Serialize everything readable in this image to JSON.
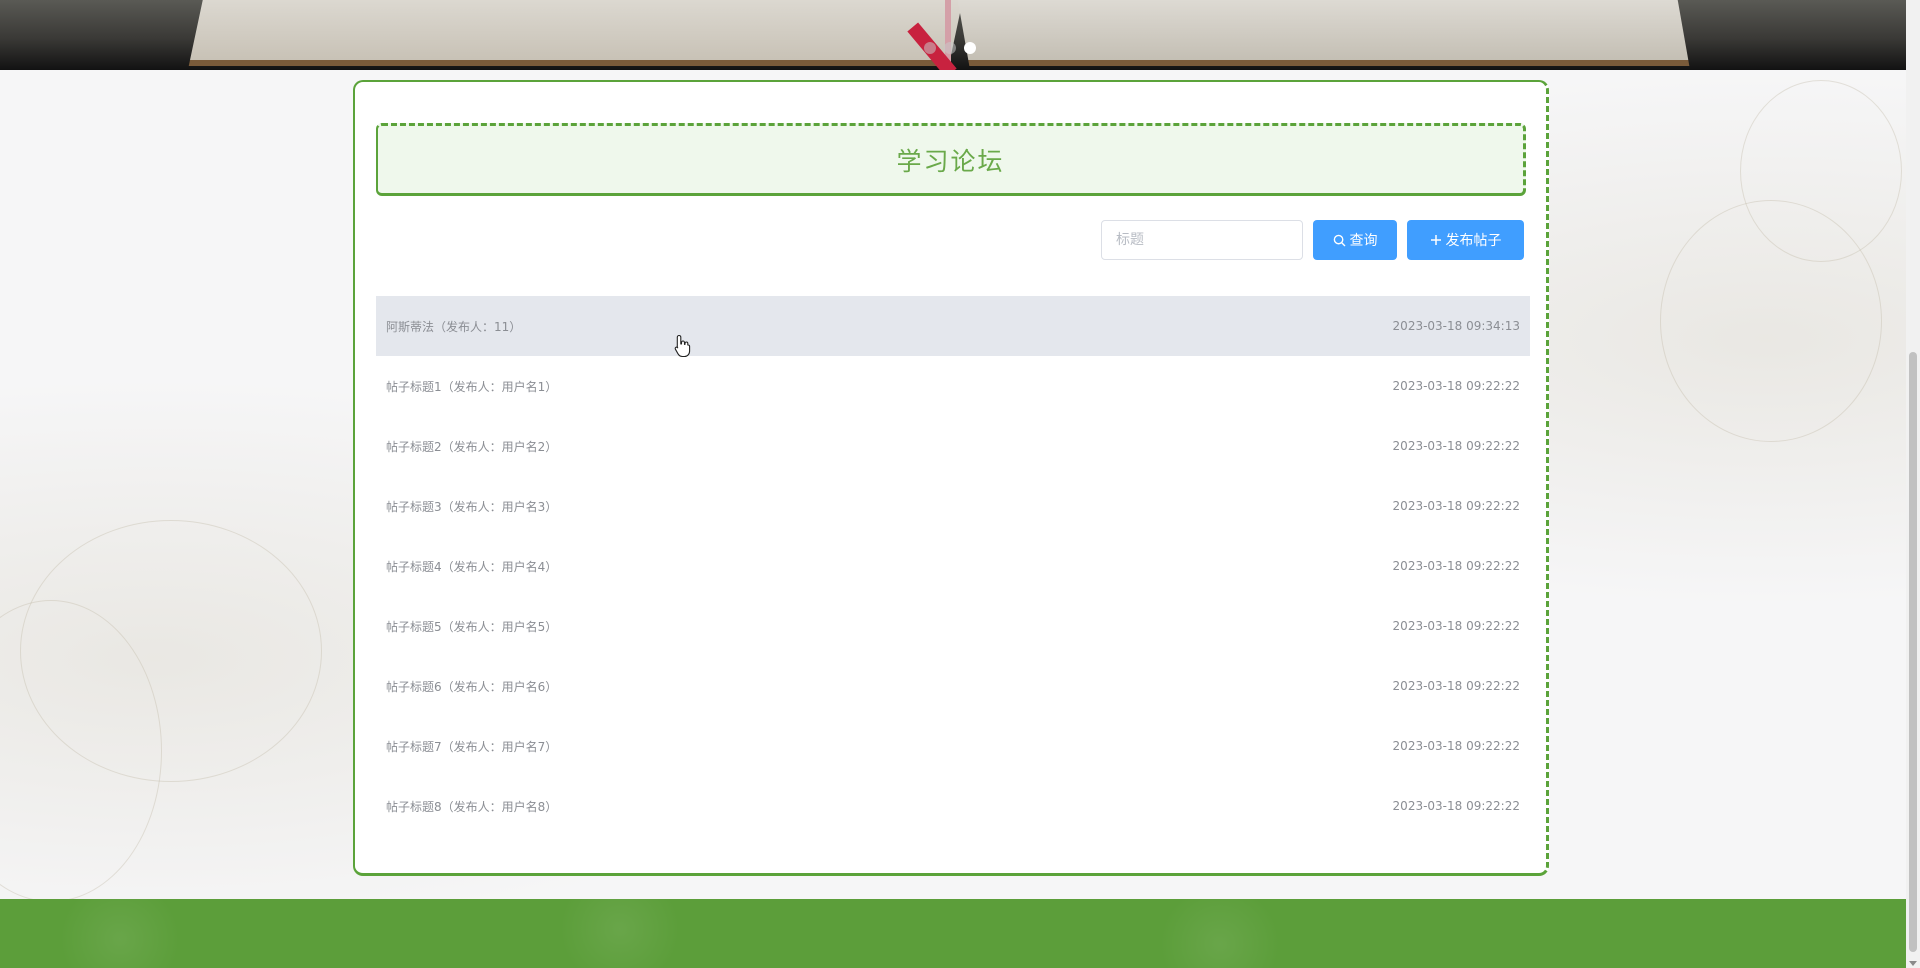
{
  "banner": {
    "slides": [
      "",
      "",
      ""
    ],
    "active_slide": 3
  },
  "forum": {
    "title": "学习论坛"
  },
  "search": {
    "placeholder": "标题",
    "value": ""
  },
  "buttons": {
    "query_label": "查询",
    "add_label": "发布帖子"
  },
  "posts": [
    {
      "label": "阿斯蒂法（发布人：11）",
      "time": "2023-03-18 09:34:13"
    },
    {
      "label": "帖子标题1（发布人：用户名1）",
      "time": "2023-03-18 09:22:22"
    },
    {
      "label": "帖子标题2（发布人：用户名2）",
      "time": "2023-03-18 09:22:22"
    },
    {
      "label": "帖子标题3（发布人：用户名3）",
      "time": "2023-03-18 09:22:22"
    },
    {
      "label": "帖子标题4（发布人：用户名4）",
      "time": "2023-03-18 09:22:22"
    },
    {
      "label": "帖子标题5（发布人：用户名5）",
      "time": "2023-03-18 09:22:22"
    },
    {
      "label": "帖子标题6（发布人：用户名6）",
      "time": "2023-03-18 09:22:22"
    },
    {
      "label": "帖子标题7（发布人：用户名7）",
      "time": "2023-03-18 09:22:22"
    },
    {
      "label": "帖子标题8（发布人：用户名8）",
      "time": "2023-03-18 09:22:22"
    }
  ],
  "colors": {
    "accent_green": "#5ba33a",
    "primary_blue": "#409eff",
    "title_green": "#6aa94a"
  },
  "icons": {
    "query": "search-icon",
    "add": "plus-icon"
  }
}
